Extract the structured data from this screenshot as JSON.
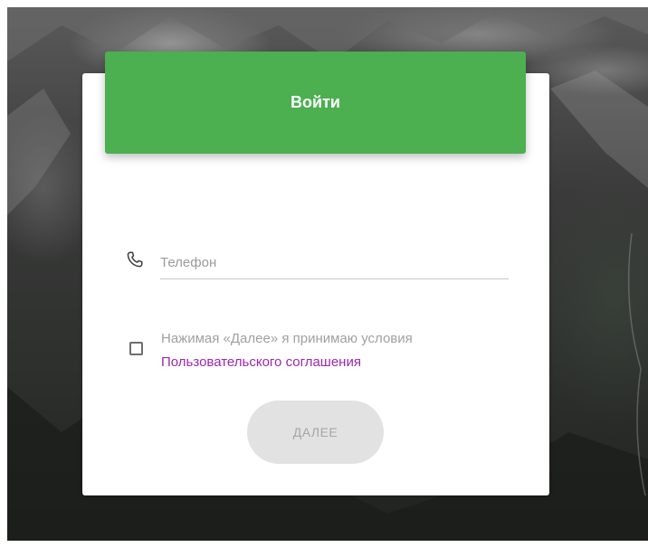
{
  "login": {
    "title": "Войти",
    "phone": {
      "placeholder": "Телефон",
      "icon": "phone-icon"
    },
    "terms": {
      "text": "Нажимая «Далее» я принимаю условия",
      "link_text": "Пользовательского соглашения",
      "checked": false
    },
    "next_button": "ДАЛЕЕ"
  },
  "colors": {
    "header_green": "#4caf50",
    "link_purple": "#9c27b0",
    "button_disabled_bg": "#e2e2e2"
  }
}
